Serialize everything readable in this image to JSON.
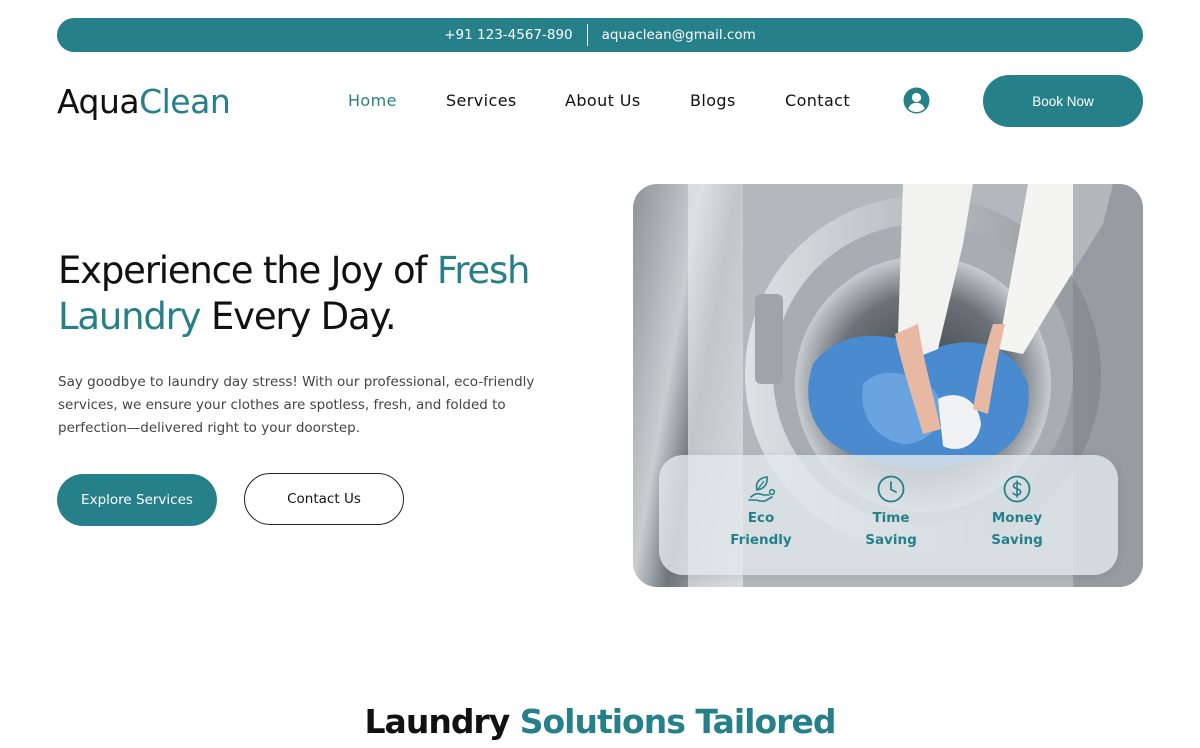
{
  "topbar": {
    "phone": "+91 123-4567-890",
    "email": "aquaclean@gmail.com"
  },
  "logo": {
    "part1": "Aqua",
    "part2": "Clean"
  },
  "nav": {
    "items": [
      "Home",
      "Services",
      "About Us",
      "Blogs",
      "Contact"
    ],
    "active": "Home",
    "account_icon": "user-circle-icon",
    "book_label": "Book Now"
  },
  "hero": {
    "title_part1": "Experience the Joy of ",
    "title_accent": "Fresh Laundry",
    "title_part2": " Every Day.",
    "text": "Say goodbye to laundry day stress! With our professional, eco-friendly services, we ensure your clothes are spotless, fresh, and folded to perfection—delivered right to your doorstep.",
    "explore_label": "Explore Services",
    "contact_label": "Contact Us",
    "features": [
      {
        "icon": "eco-hand-leaf-icon",
        "line1": "Eco",
        "line2": "Friendly"
      },
      {
        "icon": "clock-icon",
        "line1": "Time",
        "line2": "Saving"
      },
      {
        "icon": "dollar-coin-icon",
        "line1": "Money",
        "line2": "Saving"
      }
    ]
  },
  "section": {
    "title_part1": "Laundry ",
    "title_accent": "Solutions Tailored"
  },
  "colors": {
    "accent": "#26808a",
    "text": "#111111"
  }
}
